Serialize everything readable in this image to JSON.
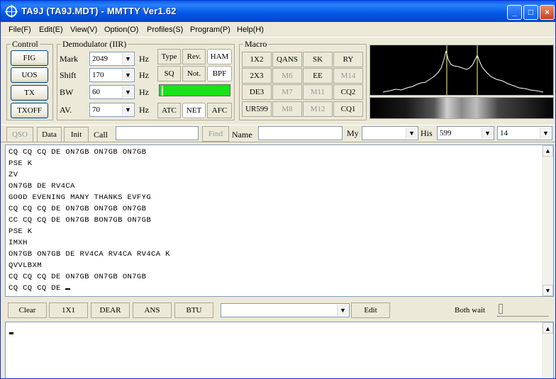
{
  "window": {
    "title": "TA9J (TA9J.MDT) - MMTTY Ver1.62",
    "min_icon": "minimize-icon",
    "max_icon": "maximize-icon",
    "close_icon": "close-icon"
  },
  "menu": [
    "File(F)",
    "Edit(E)",
    "View(V)",
    "Option(O)",
    "Profiles(S)",
    "Program(P)",
    "Help(H)"
  ],
  "control": {
    "label": "Control",
    "buttons": [
      "FIG",
      "UOS",
      "TX",
      "TXOFF"
    ]
  },
  "demod": {
    "label": "Demodulator (IIR)",
    "fields": [
      {
        "label": "Mark",
        "value": "2049",
        "unit": "Hz"
      },
      {
        "label": "Shift",
        "value": "170",
        "unit": "Hz"
      },
      {
        "label": "BW",
        "value": "60",
        "unit": "Hz"
      },
      {
        "label": "AV.",
        "value": "70",
        "unit": "Hz"
      }
    ],
    "buttons": [
      "Type",
      "Rev.",
      "HAM",
      "SQ",
      "Not.",
      "BPF",
      "ATC",
      "NET",
      "AFC"
    ]
  },
  "macro": {
    "label": "Macro",
    "buttons": [
      "1X2",
      "QANS",
      "SK",
      "RY",
      "2X3",
      "M6",
      "EE",
      "M14",
      "DE3",
      "M7",
      "M11",
      "CQ2",
      "UR599",
      "M8",
      "M12",
      "CQ1"
    ]
  },
  "callbar": {
    "qso": "QSO",
    "data": "Data",
    "init": "Init",
    "call_label": "Call",
    "call_value": "",
    "find": "Find",
    "name_label": "Name",
    "name_value": "",
    "my_label": "My",
    "my_value": "",
    "his_label": "His",
    "his_value": "599",
    "extra_value": "14"
  },
  "rx_lines": [
    "CQ CQ CQ DE ON7GB ON7GB ON7GB",
    "PSE K",
    "ZV",
    "ON7GB DE RV4CA",
    "GOOD EVENING MANY THANKS EVFYG",
    "CQ CQ CQ DE ON7GB ON7GB ON7GB",
    "CC CQ CQ DE ON7GB BON7GB ON7GB",
    "PSE K",
    "IMXH",
    "ON7GB ON7GB DE RV4CA RV4CA RV4CA K",
    "QVVLBXM",
    "CQ CQ CQ DE ON7GB ON7GB ON7GB",
    "CQ CQ CQ DE "
  ],
  "bottom": {
    "buttons": [
      "Clear",
      "1X1",
      "DEAR",
      "ANS",
      "BTU"
    ],
    "combo_value": "",
    "edit": "Edit",
    "wait_label": "Both wait"
  },
  "colors": {
    "tuning": "#18e218",
    "spectrum_bg": "#000000",
    "spectrum_line": "#ffffff",
    "marker": "#ffff80"
  }
}
